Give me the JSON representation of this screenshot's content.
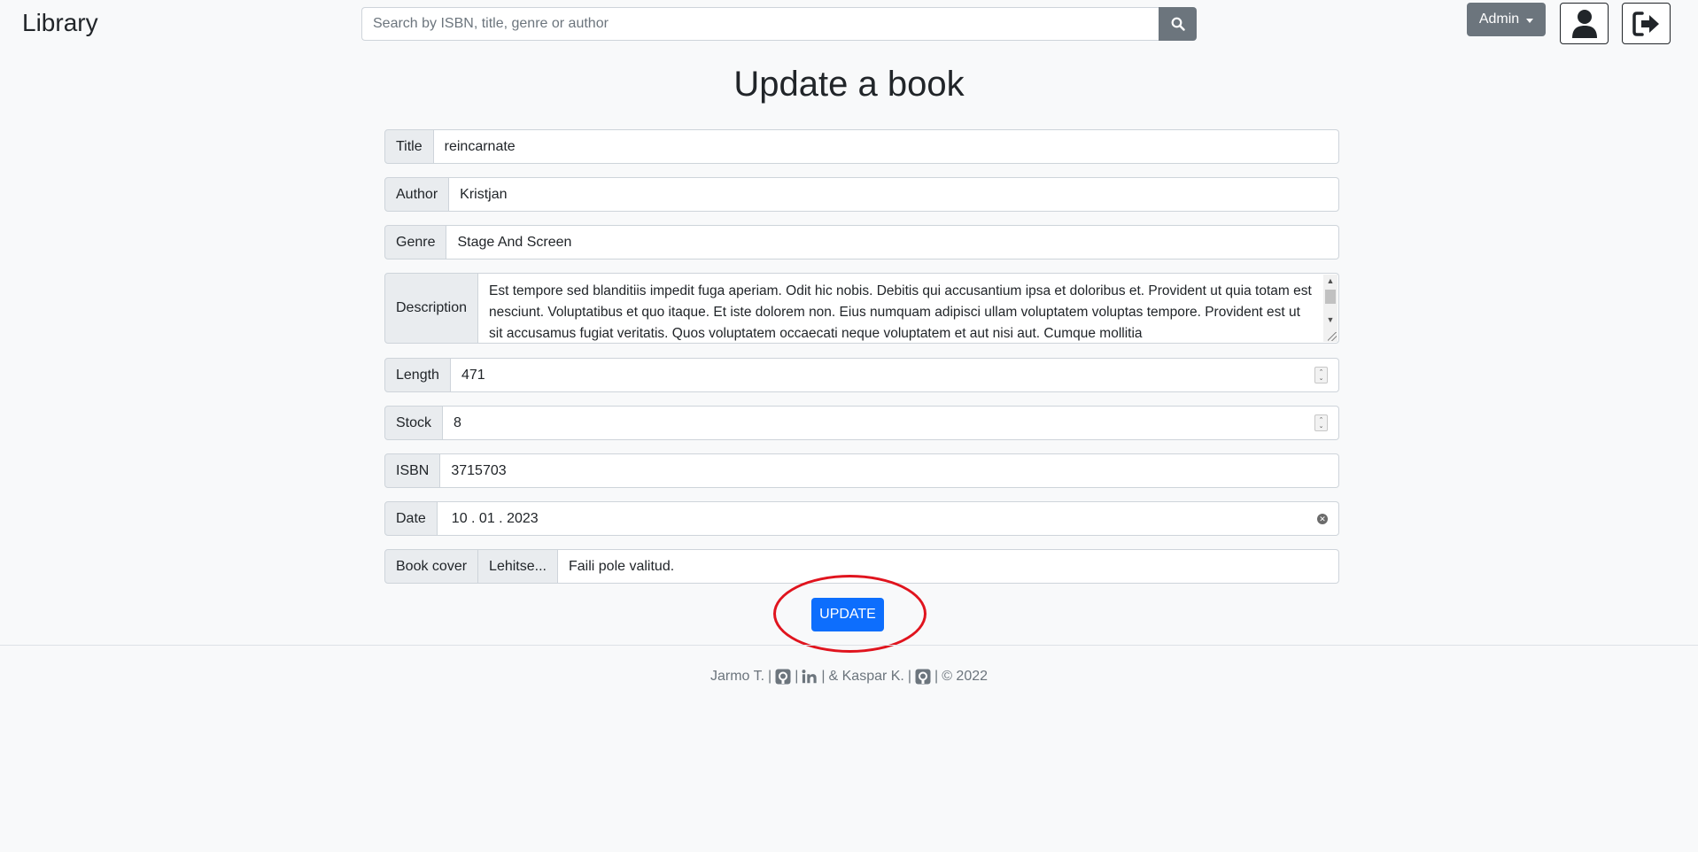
{
  "navbar": {
    "brand": "Library",
    "search_placeholder": "Search by ISBN, title, genre or author",
    "admin_label": "Admin"
  },
  "page_title": "Update a book",
  "form": {
    "title": {
      "label": "Title",
      "value": "reincarnate"
    },
    "author": {
      "label": "Author",
      "value": "Kristjan"
    },
    "genre": {
      "label": "Genre",
      "value": "Stage And Screen"
    },
    "description": {
      "label": "Description",
      "value": "Est tempore sed blanditiis impedit fuga aperiam. Odit hic nobis. Debitis qui accusantium ipsa et doloribus et. Provident ut quia totam est nesciunt. Voluptatibus et quo itaque. Et iste dolorem non. Eius numquam adipisci ullam voluptatem voluptas tempore. Provident est ut sit accusamus fugiat veritatis. Quos voluptatem occaecati neque voluptatem et aut nisi aut. Cumque mollitia"
    },
    "length": {
      "label": "Length",
      "value": "471"
    },
    "stock": {
      "label": "Stock",
      "value": "8"
    },
    "isbn": {
      "label": "ISBN",
      "value": "3715703"
    },
    "date": {
      "label": "Date",
      "value": "10 . 01 . 2023"
    },
    "cover": {
      "label": "Book cover",
      "button": "Lehitse...",
      "value": "Faili pole valitud."
    }
  },
  "update_label": "UPDATE",
  "footer": {
    "author1": "Jarmo T.",
    "sep": "|",
    "and": "& Kaspar K.",
    "copyright": "© 2022"
  },
  "colors": {
    "primary": "#0d6efd",
    "secondary": "#6c757d",
    "highlight": "#e0141e"
  }
}
